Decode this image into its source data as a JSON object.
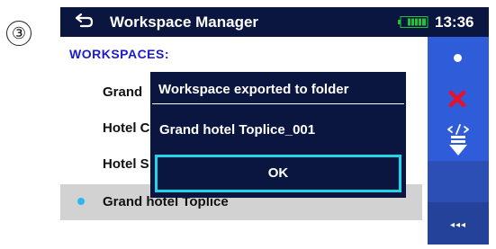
{
  "step_marker": "③",
  "header": {
    "title": "Workspace Manager",
    "time": "13:36"
  },
  "section_label": "WORKSPACES:",
  "workspaces": [
    {
      "label": "Grand",
      "selected": false
    },
    {
      "label": "Hotel C",
      "selected": false
    },
    {
      "label": "Hotel S",
      "selected": false
    },
    {
      "label": "Grand hotel Toplice",
      "selected": true
    }
  ],
  "dialog": {
    "title": "Workspace exported to folder",
    "message": "Grand hotel Toplice_001",
    "ok_label": "OK"
  },
  "sidebar": {
    "buttons": [
      {
        "icon": "dot-icon"
      },
      {
        "icon": "close-icon"
      },
      {
        "icon": "export-icon"
      },
      {
        "icon": "empty"
      },
      {
        "icon": "more-icon",
        "label": "◂◂◂"
      }
    ]
  },
  "colors": {
    "header_bg": "#0a1540",
    "accent_blue": "#2f5cd8",
    "selection_dot": "#2bb8ee",
    "dialog_border_focus": "#25d3e8",
    "section_label": "#1a1ad0"
  }
}
